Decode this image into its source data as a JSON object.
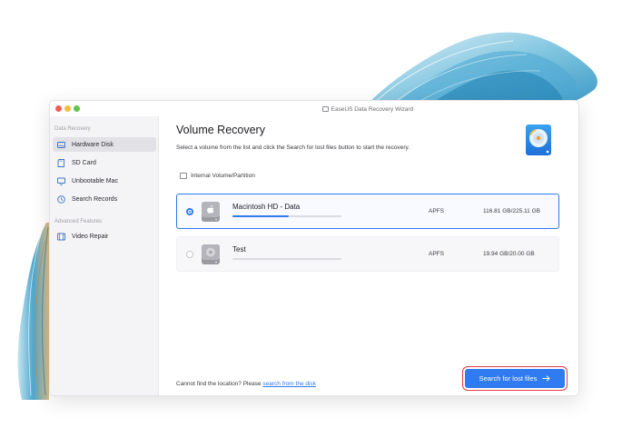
{
  "window": {
    "title": "EaseUS Data Recovery Wizard",
    "traffic_lights": [
      "#ec5f57",
      "#f4bd40",
      "#5fc34d"
    ]
  },
  "sidebar": {
    "sections": [
      {
        "label": "Data Recovery",
        "items": [
          {
            "label": "Hardware Disk",
            "icon": "hard-drive-icon",
            "active": true
          },
          {
            "label": "SD Card",
            "icon": "sd-card-icon",
            "active": false
          },
          {
            "label": "Unbootable Mac",
            "icon": "monitor-icon",
            "active": false
          },
          {
            "label": "Search Records",
            "icon": "clock-search-icon",
            "active": false
          }
        ]
      },
      {
        "label": "Advanced Features",
        "items": [
          {
            "label": "Video Repair",
            "icon": "film-icon",
            "active": false
          }
        ]
      }
    ]
  },
  "main": {
    "title": "Volume Recovery",
    "subtitle": "Select a volume from the list and click the Search for lost files button to start the recovery.",
    "section_label": "Internal Volume/Partition",
    "volumes": [
      {
        "name": "Macintosh HD - Data",
        "filesystem": "APFS",
        "size": "116.81 GB/225.11 GB",
        "used_fraction": 0.52,
        "selected": true,
        "icon": "apple-drive-icon"
      },
      {
        "name": "Test",
        "filesystem": "APFS",
        "size": "19.94 GB/20.00 GB",
        "used_fraction": 0.0,
        "selected": false,
        "icon": "drive-icon"
      }
    ],
    "footer_text": "Cannot find the location? Please",
    "footer_link": "search from the disk",
    "search_button": {
      "label": "Search for lost files",
      "icon": "arrow-right-icon"
    }
  },
  "colors": {
    "accent": "#2f7bef",
    "highlight_outline": "#e23b3b",
    "sidebar_bg": "#f4f4f6"
  }
}
